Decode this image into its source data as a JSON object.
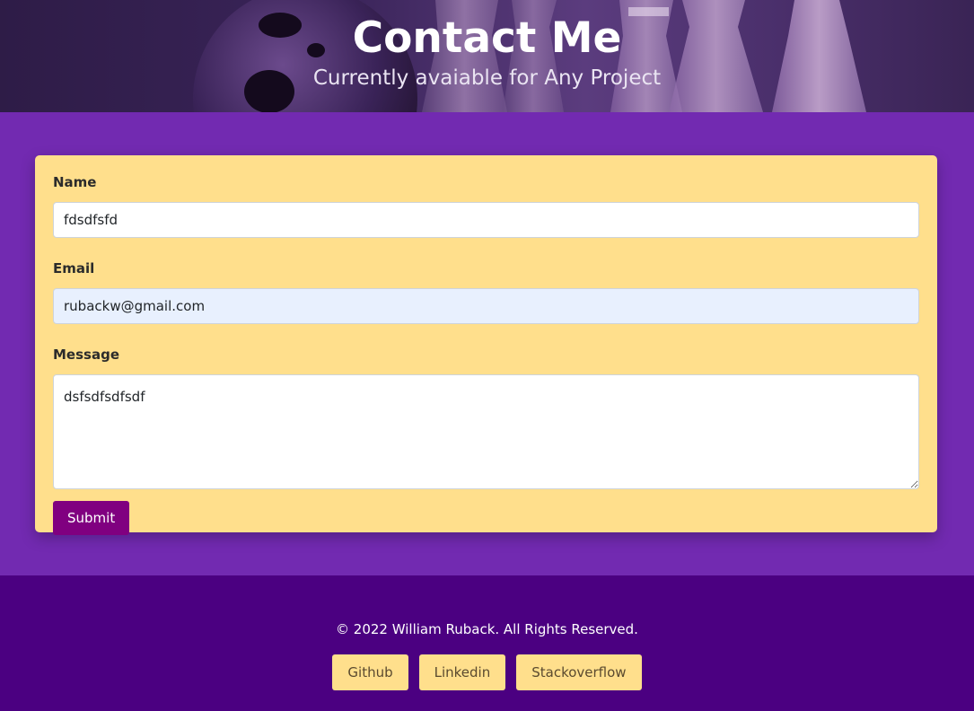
{
  "hero": {
    "title": "Contact Me",
    "subtitle": "Currently avaiable for Any Project"
  },
  "form": {
    "name_label": "Name",
    "name_value": "fdsdfsfd",
    "email_label": "Email",
    "email_value": "rubackw@gmail.com",
    "message_label": "Message",
    "message_value": "dsfsdfsdfsdf",
    "submit_label": "Submit"
  },
  "footer": {
    "copyright": "© 2022 William Ruback. All Rights Reserved.",
    "links": [
      {
        "label": "Github"
      },
      {
        "label": "Linkedin"
      },
      {
        "label": "Stackoverflow"
      }
    ]
  },
  "colors": {
    "page_background": "#722ab1",
    "card_background": "#ffdf8c",
    "submit_button": "#800080",
    "footer_background": "#4b0081"
  }
}
